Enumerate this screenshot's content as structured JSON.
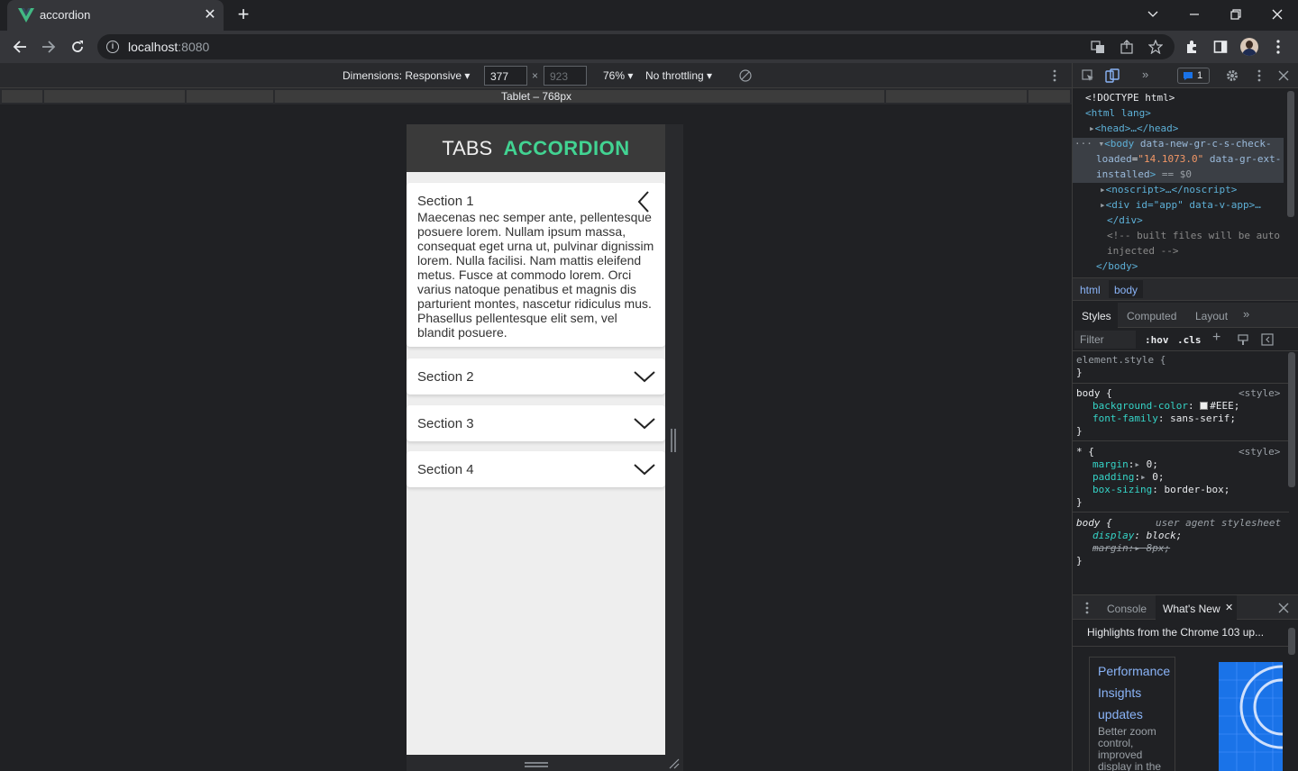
{
  "browser": {
    "tab_title": "accordion",
    "tab_close": "✕",
    "new_tab": "+",
    "url_host": "localhost",
    "url_port": ":8080"
  },
  "device_toolbar": {
    "dimensions_label": "Dimensions: Responsive",
    "width": "377",
    "height": "923",
    "zoom": "76%",
    "throttling": "No throttling",
    "media_label": "Tablet – 768px"
  },
  "app": {
    "title_plain": "TABS",
    "title_accent": "ACCORDION",
    "accent_color": "#42d392",
    "sections": [
      {
        "label": "Section 1",
        "expanded": true,
        "body": "Maecenas nec semper ante, pellentesque posuere lorem. Nullam ipsum massa, consequat eget urna ut, pulvinar dignissim lorem. Nulla facilisi. Nam mattis eleifend metus. Fusce at commodo lorem. Orci varius natoque penatibus et magnis dis parturient montes, nascetur ridiculus mus. Phasellus pellentesque elit sem, vel blandit posuere."
      },
      {
        "label": "Section 2",
        "expanded": false
      },
      {
        "label": "Section 3",
        "expanded": false
      },
      {
        "label": "Section 4",
        "expanded": false
      }
    ]
  },
  "devtools": {
    "issues_count": "1",
    "elements": {
      "doctype": "<!DOCTYPE html>",
      "html_open": "<html lang>",
      "head": "<head>…</head>",
      "body_tag": "<body",
      "body_attr1": "data-new-gr-c-s-check-",
      "body_attr1b": "loaded",
      "body_val1": "\"14.1073.0\"",
      "body_attr2": "data-gr-ext-",
      "body_attr2b": "installed",
      "body_eq": "== $0",
      "noscript": "<noscript>…</noscript>",
      "div_app": "<div id=\"app\" data-v-app>…",
      "div_close": "</div>",
      "comment1": "<!-- built files will be auto",
      "comment2": "injected -->",
      "body_close": "</body>"
    },
    "breadcrumb": [
      "html",
      "body"
    ],
    "style_tabs": [
      "Styles",
      "Computed",
      "Layout"
    ],
    "filter_placeholder": "Filter",
    "hov": ":hov",
    "cls": ".cls",
    "rules": {
      "element_style": "element.style {",
      "close": "}",
      "body_sel": "body {",
      "style_src": "<style>",
      "bg_prop": "background-color",
      "bg_val": "#EEE;",
      "ff_prop": "font-family",
      "ff_val": "sans-serif;",
      "star_sel": "* {",
      "margin_prop": "margin",
      "margin_val": "0;",
      "padding_prop": "padding",
      "padding_val": "0;",
      "bs_prop": "box-sizing",
      "bs_val": "border-box;",
      "ua_sel": "body {",
      "ua_src": "user agent stylesheet",
      "display_prop": "display",
      "display_val": "block;",
      "ua_margin_prop": "margin",
      "ua_margin_val": "8px;"
    },
    "drawer_tabs": [
      "Console",
      "What's New"
    ],
    "whats_new_heading": "Highlights from the Chrome 103 up...",
    "whats_new_links": [
      "Performance",
      "Insights",
      "updates"
    ],
    "whats_new_text": "Better zoom control, improved display in the"
  }
}
